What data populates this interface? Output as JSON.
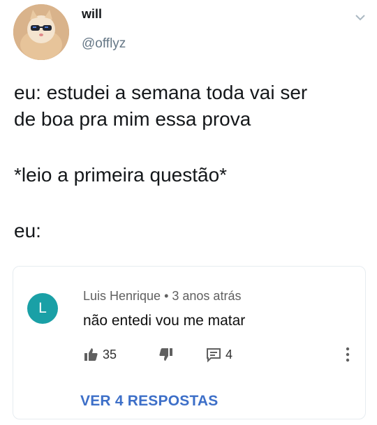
{
  "tweet": {
    "author_name": "will",
    "author_handle": "@offlyz",
    "avatar_icon": "cat-with-sunglasses-avatar",
    "lines": [
      "eu: estudei a semana toda vai ser",
      "de boa pra mim essa prova",
      "*leio a primeira questão*",
      "eu:"
    ]
  },
  "comment": {
    "avatar_letter": "L",
    "avatar_color": "#1aa0a6",
    "author": "Luis Henrique",
    "separator": "•",
    "time": "3 anos atrás",
    "text": "não entedi vou me matar",
    "likes": "35",
    "replies_count": "4",
    "view_replies_label": "VER 4 RESPOSTAS"
  },
  "colors": {
    "link": "#3d6fc8",
    "handle": "#657786"
  }
}
